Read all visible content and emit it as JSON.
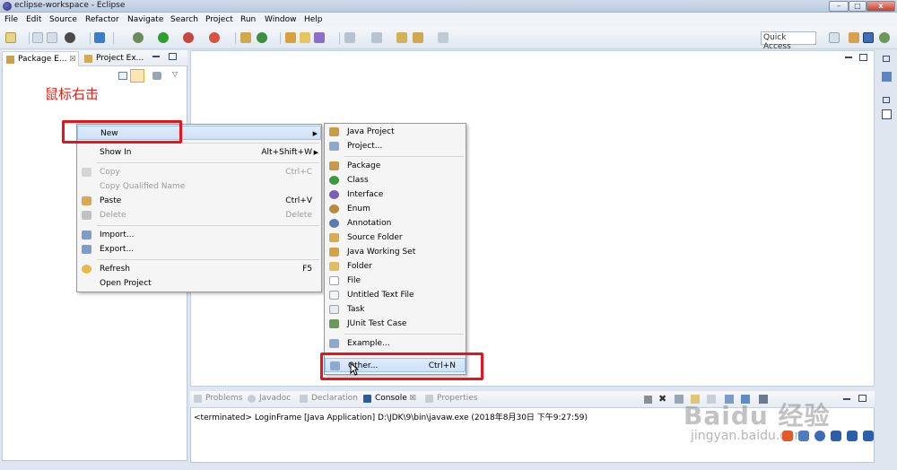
{
  "window": {
    "title": "eclipse-workspace - Eclipse",
    "minimize": "–",
    "maximize": "□",
    "close": "x"
  },
  "menubar": [
    "File",
    "Edit",
    "Source",
    "Refactor",
    "Navigate",
    "Search",
    "Project",
    "Run",
    "Window",
    "Help"
  ],
  "toolbar": {
    "quick_access": "Quick Access"
  },
  "left_view": {
    "tabs": [
      {
        "label": "Package E...",
        "close": "☒"
      },
      {
        "label": "Project Ex...",
        "close": "☒"
      }
    ]
  },
  "annotation": "鼠标右击",
  "context_menu": {
    "items": [
      {
        "label": "New",
        "accel": "",
        "submenu": true,
        "enabled": true,
        "icon": ""
      },
      {
        "label": "Show In",
        "accel": "Alt+Shift+W",
        "submenu": true,
        "enabled": true,
        "icon": ""
      },
      {
        "label": "Copy",
        "accel": "Ctrl+C",
        "enabled": false,
        "icon": "copy-icon"
      },
      {
        "label": "Copy Qualified Name",
        "accel": "",
        "enabled": false,
        "icon": ""
      },
      {
        "label": "Paste",
        "accel": "Ctrl+V",
        "enabled": true,
        "icon": "paste-icon"
      },
      {
        "label": "Delete",
        "accel": "Delete",
        "enabled": false,
        "icon": "delete-icon"
      },
      {
        "label": "Import...",
        "accel": "",
        "enabled": true,
        "icon": "import-icon"
      },
      {
        "label": "Export...",
        "accel": "",
        "enabled": true,
        "icon": "export-icon"
      },
      {
        "label": "Refresh",
        "accel": "F5",
        "enabled": true,
        "icon": "refresh-icon"
      },
      {
        "label": "Open Project",
        "accel": "",
        "enabled": true,
        "icon": ""
      }
    ]
  },
  "new_submenu": {
    "items": [
      {
        "label": "Java Project",
        "icon": "java-project-icon",
        "accel": ""
      },
      {
        "label": "Project...",
        "icon": "project-icon",
        "accel": ""
      },
      {
        "label": "Package",
        "icon": "package-icon",
        "accel": ""
      },
      {
        "label": "Class",
        "icon": "class-icon",
        "accel": ""
      },
      {
        "label": "Interface",
        "icon": "interface-icon",
        "accel": ""
      },
      {
        "label": "Enum",
        "icon": "enum-icon",
        "accel": ""
      },
      {
        "label": "Annotation",
        "icon": "annotation-icon",
        "accel": ""
      },
      {
        "label": "Source Folder",
        "icon": "source-folder-icon",
        "accel": ""
      },
      {
        "label": "Java Working Set",
        "icon": "working-set-icon",
        "accel": ""
      },
      {
        "label": "Folder",
        "icon": "folder-icon",
        "accel": ""
      },
      {
        "label": "File",
        "icon": "file-icon",
        "accel": ""
      },
      {
        "label": "Untitled Text File",
        "icon": "text-file-icon",
        "accel": ""
      },
      {
        "label": "Task",
        "icon": "task-icon",
        "accel": ""
      },
      {
        "label": "JUnit Test Case",
        "icon": "junit-icon",
        "accel": ""
      },
      {
        "label": "Example...",
        "icon": "example-icon",
        "accel": ""
      },
      {
        "label": "Other...",
        "icon": "other-icon",
        "accel": "Ctrl+N"
      }
    ]
  },
  "console": {
    "tabs": [
      "Problems",
      "Javadoc",
      "Declaration",
      "Console",
      "Properties"
    ],
    "active_tab": "Console",
    "line": "<terminated> LoginFrame [Java Application] D:\\JDK\\9\\bin\\javaw.exe (2018年8月30日 下午9:27:59)"
  },
  "watermark": {
    "logo": "Baidu 经验",
    "url": "jingyan.baidu.com"
  },
  "colors": {
    "highlight_red": "#e8131c",
    "annotation_red": "#e0201a",
    "menu_hover": "#cde1f7"
  }
}
